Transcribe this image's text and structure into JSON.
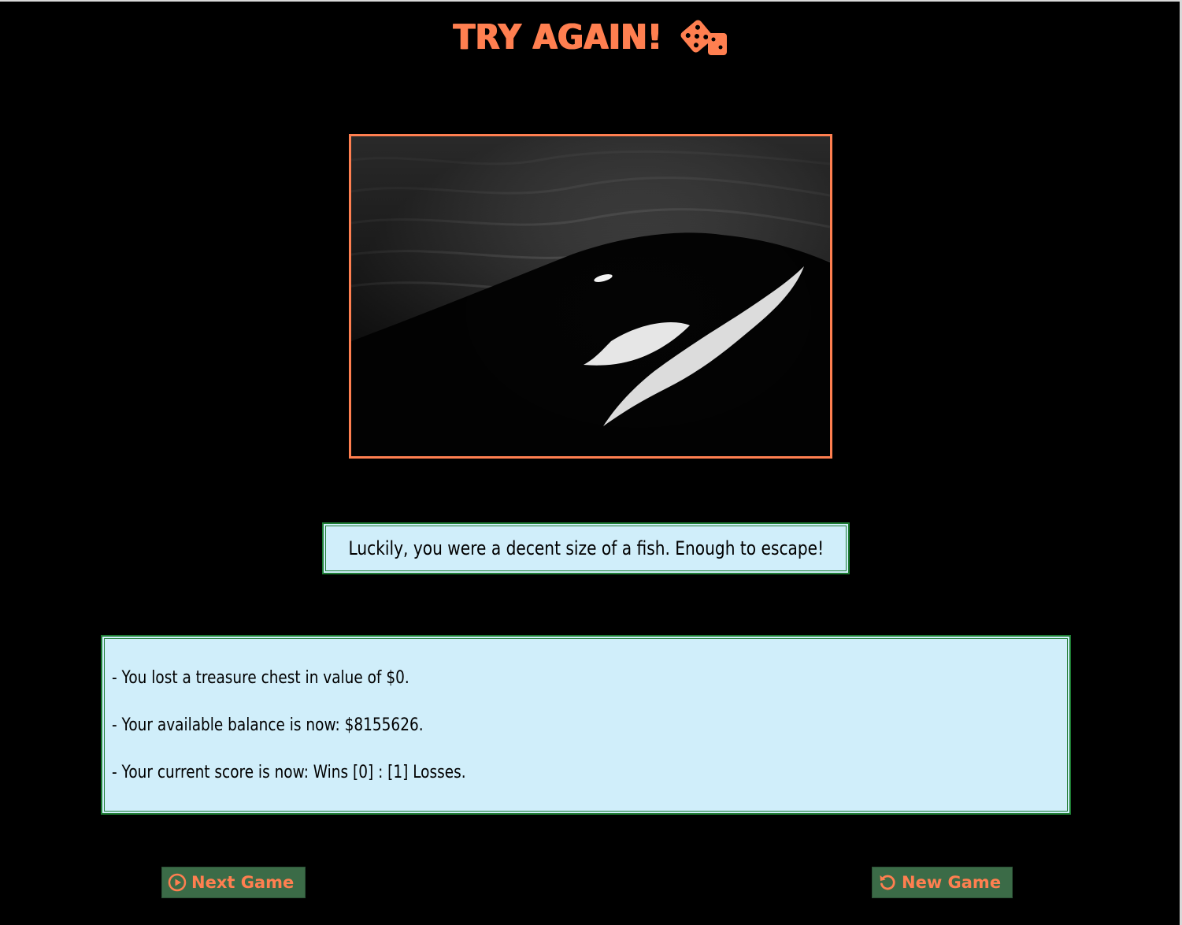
{
  "header": {
    "title": "TRY AGAIN!",
    "icon": "dice-icon"
  },
  "image": {
    "subject": "orca-photo",
    "icon": "orca-photo"
  },
  "message": {
    "text": "Luckily, you were a decent size of a fish. Enough to escape!"
  },
  "results": {
    "lines": [
      "- You lost a treasure chest in value of $0.",
      "- Your available balance is now: $8155626.",
      "- Your current score is now: Wins [0] : [1] Losses."
    ]
  },
  "buttons": {
    "next_game": {
      "label": "Next Game",
      "icon": "play-circle-icon"
    },
    "new_game": {
      "label": "New Game",
      "icon": "rotate-left-icon"
    }
  },
  "colors": {
    "accent": "#ff7f50",
    "panel": "#d0eefa",
    "panel_border": "#1e7d34",
    "button_bg": "#3b6b47",
    "background": "#000000"
  }
}
